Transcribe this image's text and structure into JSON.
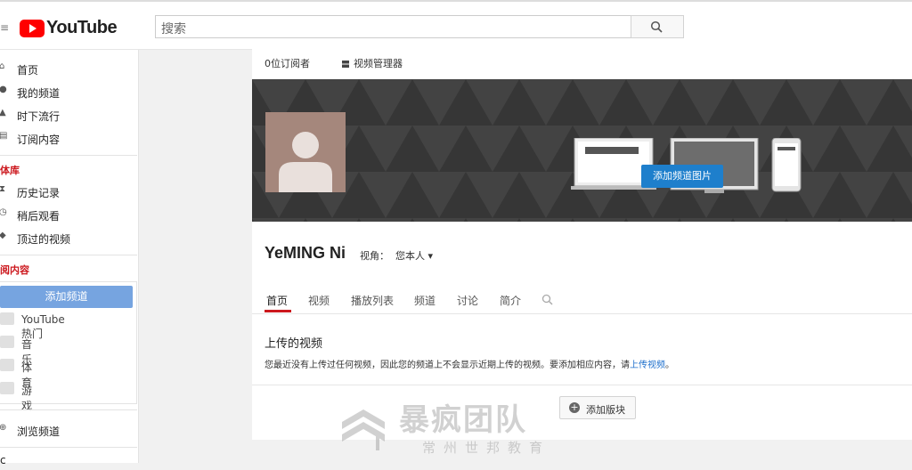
{
  "header": {
    "logo_text": "YouTube",
    "search_placeholder": "搜索"
  },
  "sidebar": {
    "items": [
      "首页",
      "我的频道",
      "时下流行",
      "订阅内容"
    ],
    "library_title": "体库",
    "library": [
      "历史记录",
      "稍后观看",
      "顶过的视频"
    ],
    "subs_title": "阅内容",
    "add_channel": "添加频道",
    "subs": [
      "YouTube 热门",
      "音乐",
      "体育",
      "游戏"
    ],
    "browse": "浏览频道",
    "bottom_partial": "c"
  },
  "channel": {
    "subscribers": "0位订阅者",
    "video_manager": "视频管理器",
    "add_art": "添加频道图片",
    "name": "YeMING Ni",
    "view_label": "视角：",
    "view_value": "您本人 ▾",
    "tabs": [
      "首页",
      "视频",
      "播放列表",
      "频道",
      "讨论",
      "简介"
    ],
    "section_title": "上传的视频",
    "section_text_1": "您最近没有上传过任何视频，因此您的频道上不会显示近期上传的视频。要添加相应内容，请",
    "section_link": "上传视频",
    "section_text_2": "。",
    "add_section": "添加版块"
  },
  "watermark": {
    "big": "暴疯团队",
    "small": "常州世邦教育"
  }
}
